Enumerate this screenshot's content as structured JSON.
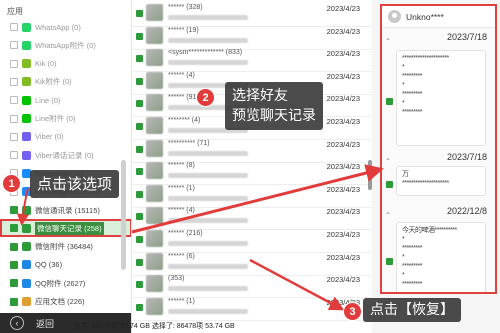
{
  "sidebar": {
    "header": "应用",
    "items": [
      {
        "label": "WhatsApp (0)",
        "checked": false,
        "color": "#25d366",
        "dark": false
      },
      {
        "label": "WhatsApp附件 (0)",
        "checked": false,
        "color": "#25d366",
        "dark": false
      },
      {
        "label": "Kik (0)",
        "checked": false,
        "color": "#82bc23",
        "dark": false
      },
      {
        "label": "Kik附件 (0)",
        "checked": false,
        "color": "#82bc23",
        "dark": false
      },
      {
        "label": "Line (0)",
        "checked": false,
        "color": "#00c300",
        "dark": false
      },
      {
        "label": "Line附件 (0)",
        "checked": false,
        "color": "#00c300",
        "dark": false
      },
      {
        "label": "Viber (0)",
        "checked": false,
        "color": "#7360f2",
        "dark": false
      },
      {
        "label": "Viber通话记录 (0)",
        "checked": false,
        "color": "#7360f2",
        "dark": false
      },
      {
        "label": "Messenger (0)",
        "checked": false,
        "color": "#1a8cff",
        "dark": false
      },
      {
        "label": "Messenger附件 (0)",
        "checked": false,
        "color": "#1a8cff",
        "dark": false
      },
      {
        "label": "微信通讯录 (15115)",
        "checked": true,
        "color": "#2e9b3a",
        "dark": true
      },
      {
        "label": "微信聊天记录 (258)",
        "checked": true,
        "color": "#2e9b3a",
        "dark": true,
        "selected": true
      },
      {
        "label": "微信附件 (36484)",
        "checked": true,
        "color": "#2e9b3a",
        "dark": true
      },
      {
        "label": "QQ (36)",
        "checked": true,
        "color": "#1e88e5",
        "dark": true
      },
      {
        "label": "QQ附件 (2627)",
        "checked": true,
        "color": "#1e88e5",
        "dark": true
      },
      {
        "label": "应用文档 (226)",
        "checked": true,
        "color": "#e0a030",
        "dark": true
      }
    ],
    "back_label": "返回",
    "back_icon": "chevron-left-icon"
  },
  "chat_list": [
    {
      "name": "****** (328)",
      "date": "2023/4/23"
    },
    {
      "name": "****** (19)",
      "date": "2023/4/23"
    },
    {
      "name": "<sysm************* (833)",
      "date": "2023/4/23"
    },
    {
      "name": "****** (4)",
      "date": "2023/4/23"
    },
    {
      "name": "****** (915)",
      "date": "2023/4/23"
    },
    {
      "name": "******** (4)",
      "date": "2023/4/23"
    },
    {
      "name": "********** (71)",
      "date": "2023/4/23"
    },
    {
      "name": "****** (8)",
      "date": "2023/4/23"
    },
    {
      "name": "****** (1)",
      "date": "2023/4/23"
    },
    {
      "name": "****** (4)",
      "date": "2023/4/23"
    },
    {
      "name": "****** (216)",
      "date": "2023/4/23"
    },
    {
      "name": "****** (6)",
      "date": "2023/4/23"
    },
    {
      "name": "(353)",
      "date": "2023/4/23"
    },
    {
      "name": "****** (1)",
      "date": "2023/4/23"
    }
  ],
  "footer": "总共: 86478项 53.74 GB 选择了: 86478项 53.74 GB",
  "detail": {
    "contact_name": "Unkno****",
    "avatar_icon": "user-icon",
    "groups": [
      {
        "date": "2023/7/18",
        "lines": [
          "*********************",
          "*",
          "*********",
          "*",
          "*********",
          "*",
          "*********"
        ]
      },
      {
        "date": "2023/7/18",
        "lines": [
          "万",
          "*********************"
        ]
      },
      {
        "date": "2022/12/8",
        "lines": [
          "今天的啤酒**********",
          "*",
          "*********",
          "*",
          "*********",
          "*",
          "*********"
        ]
      }
    ]
  },
  "annotations": [
    {
      "num": "1",
      "text": "点击该选项"
    },
    {
      "num": "2",
      "text": "选择好友\n预览聊天记录"
    },
    {
      "num": "3",
      "text": "点击【恢复】"
    }
  ],
  "colors": {
    "accent_red": "#e04040",
    "wechat_green": "#2e9b3a",
    "callout_bg": "#333333"
  }
}
